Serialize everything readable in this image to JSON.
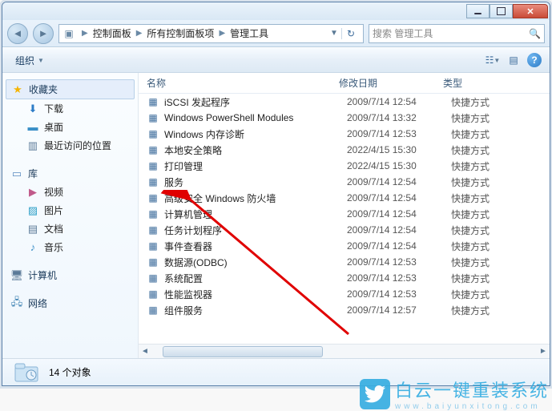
{
  "breadcrumb": [
    "控制面板",
    "所有控制面板项",
    "管理工具"
  ],
  "search_placeholder": "搜索 管理工具",
  "toolbar": {
    "organize": "组织"
  },
  "sidebar": {
    "favorites": "收藏夹",
    "downloads": "下载",
    "desktop": "桌面",
    "recent": "最近访问的位置",
    "libraries": "库",
    "videos": "视频",
    "pictures": "图片",
    "documents": "文档",
    "music": "音乐",
    "computer": "计算机",
    "network": "网络"
  },
  "columns": {
    "name": "名称",
    "date": "修改日期",
    "type": "类型"
  },
  "rows": [
    {
      "name": "iSCSI 发起程序",
      "date": "2009/7/14 12:54",
      "type": "快捷方式"
    },
    {
      "name": "Windows PowerShell Modules",
      "date": "2009/7/14 13:32",
      "type": "快捷方式"
    },
    {
      "name": "Windows 内存诊断",
      "date": "2009/7/14 12:53",
      "type": "快捷方式"
    },
    {
      "name": "本地安全策略",
      "date": "2022/4/15 15:30",
      "type": "快捷方式"
    },
    {
      "name": "打印管理",
      "date": "2022/4/15 15:30",
      "type": "快捷方式"
    },
    {
      "name": "服务",
      "date": "2009/7/14 12:54",
      "type": "快捷方式"
    },
    {
      "name": "高级安全 Windows 防火墙",
      "date": "2009/7/14 12:54",
      "type": "快捷方式"
    },
    {
      "name": "计算机管理",
      "date": "2009/7/14 12:54",
      "type": "快捷方式"
    },
    {
      "name": "任务计划程序",
      "date": "2009/7/14 12:54",
      "type": "快捷方式"
    },
    {
      "name": "事件查看器",
      "date": "2009/7/14 12:54",
      "type": "快捷方式"
    },
    {
      "name": "数据源(ODBC)",
      "date": "2009/7/14 12:53",
      "type": "快捷方式"
    },
    {
      "name": "系统配置",
      "date": "2009/7/14 12:53",
      "type": "快捷方式"
    },
    {
      "name": "性能监视器",
      "date": "2009/7/14 12:53",
      "type": "快捷方式"
    },
    {
      "name": "组件服务",
      "date": "2009/7/14 12:57",
      "type": "快捷方式"
    }
  ],
  "status": {
    "count_label": "14 个对象"
  },
  "watermark": {
    "main": "白云一键重装系统",
    "sub": "www.baiyunxitong.com"
  }
}
